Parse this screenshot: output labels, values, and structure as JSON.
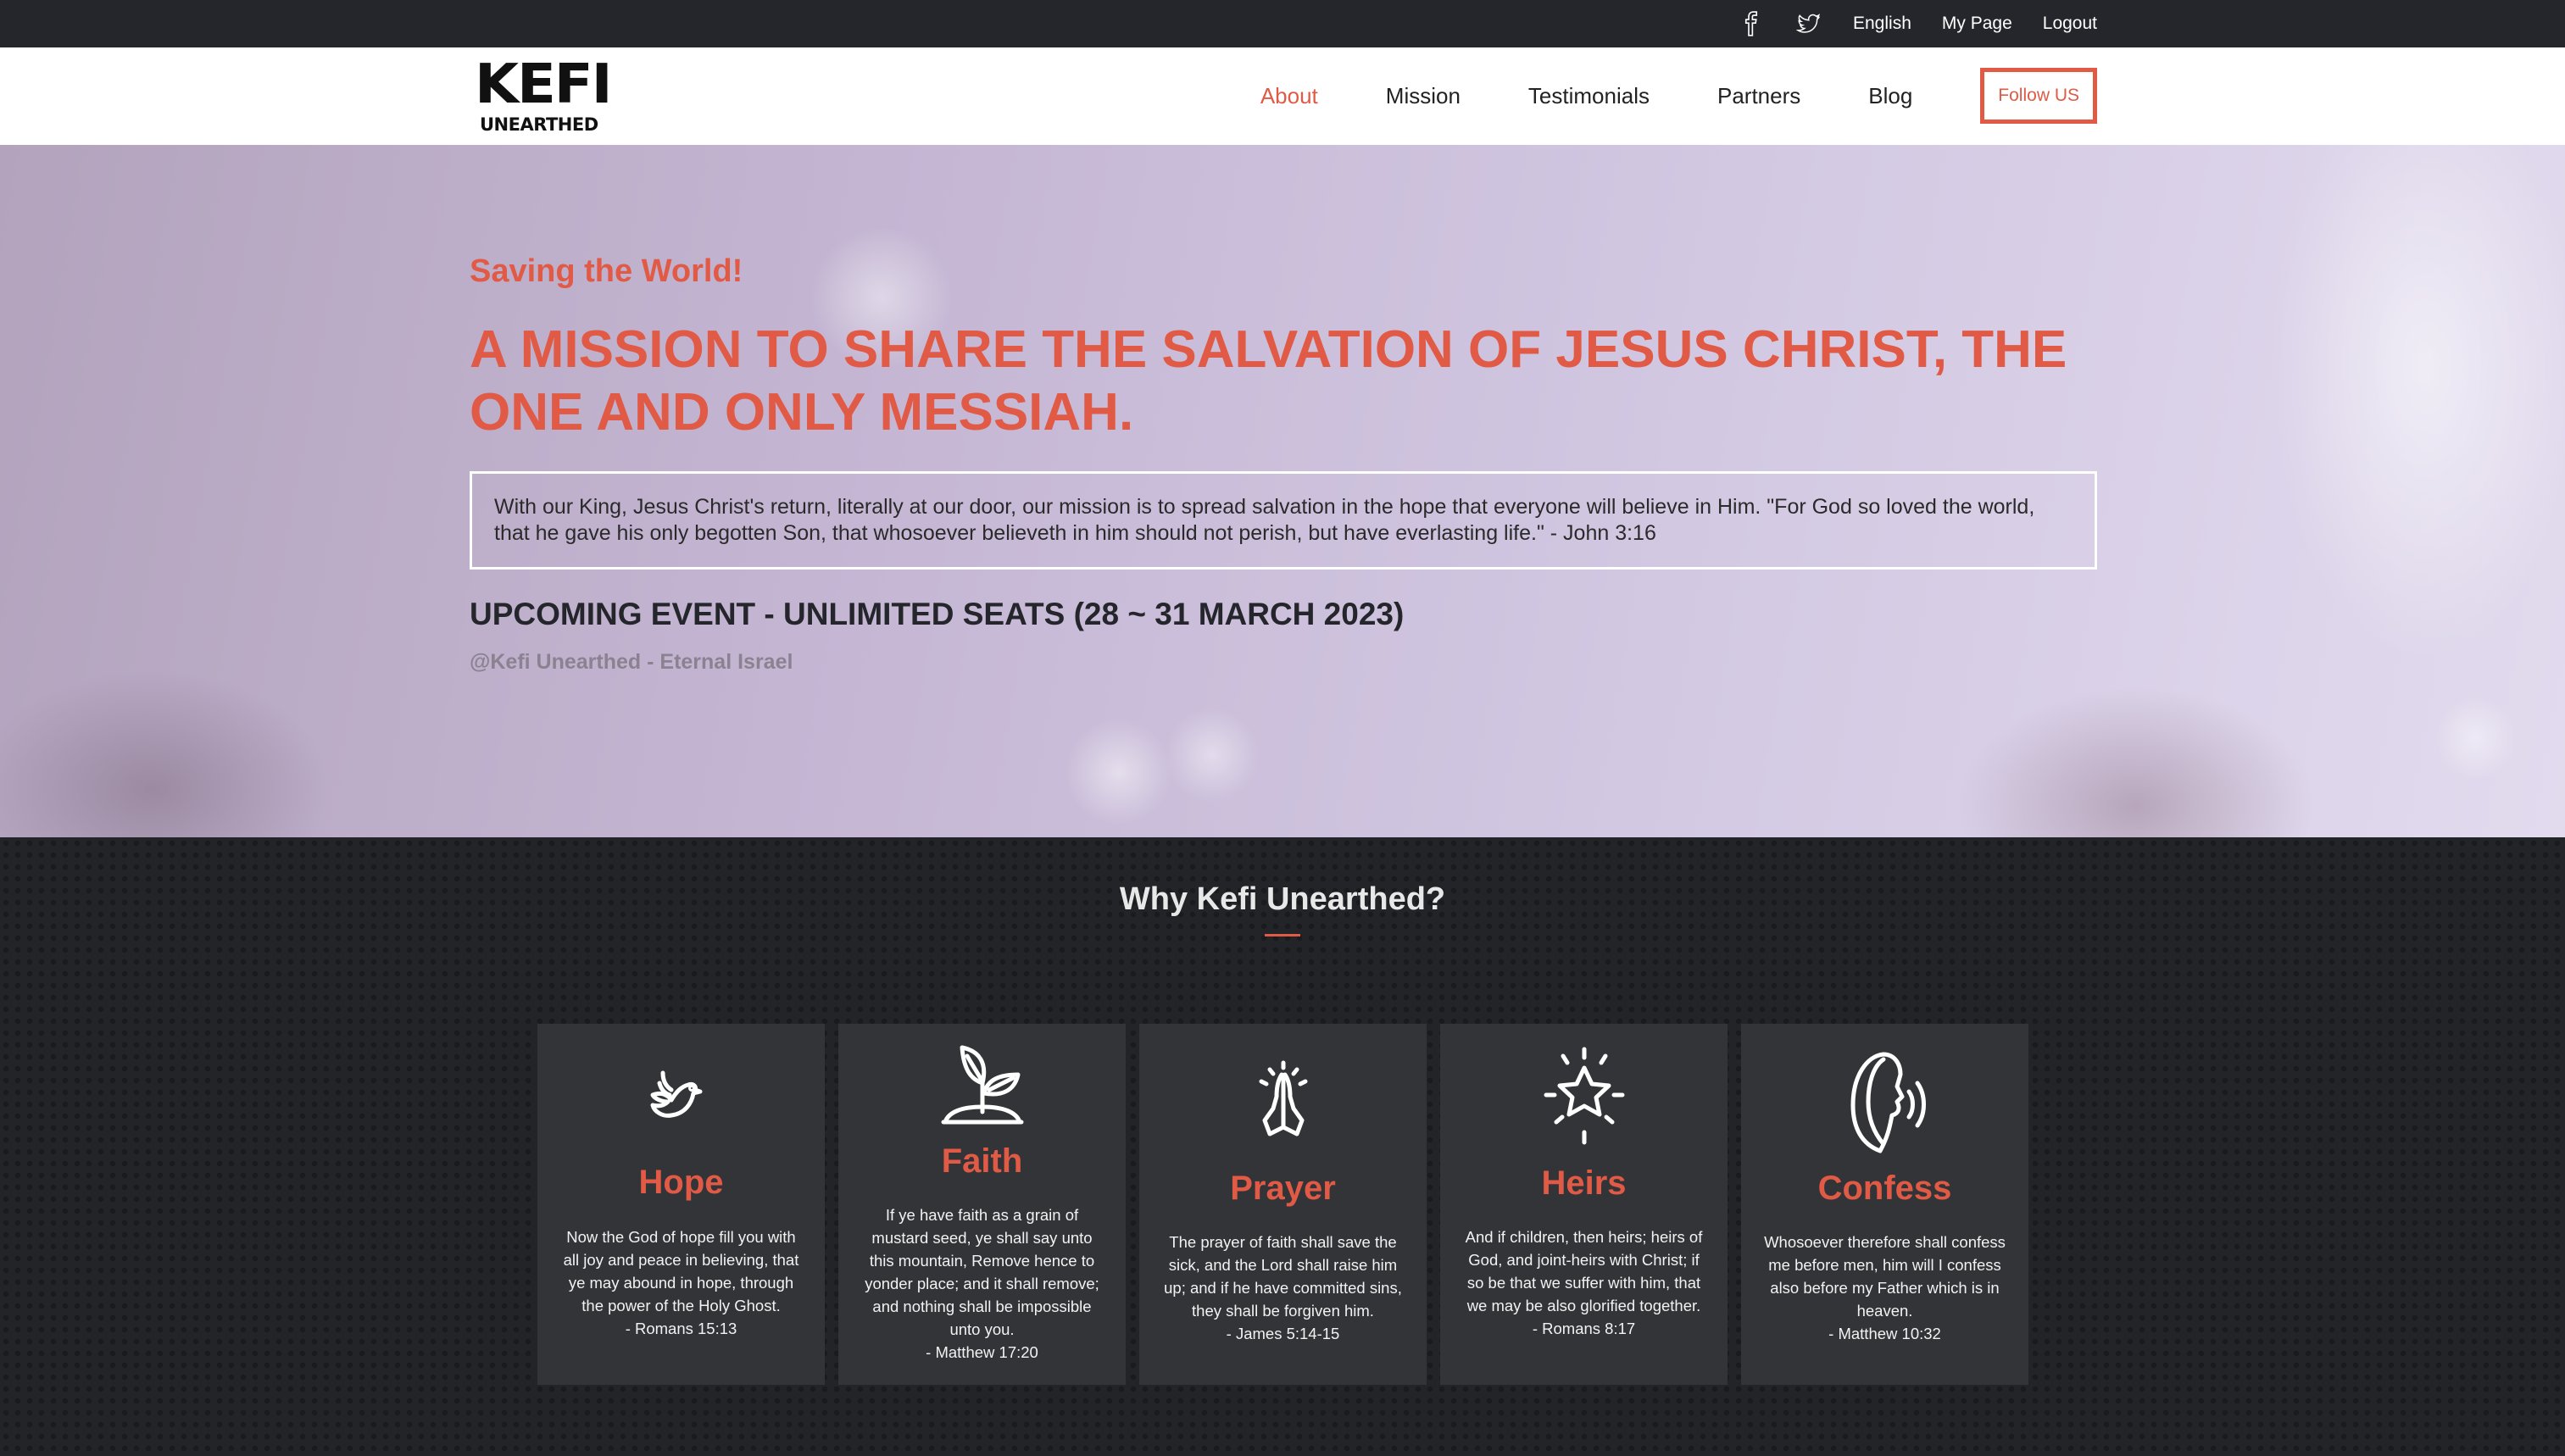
{
  "topbar": {
    "social": [
      {
        "icon": "facebook-icon"
      },
      {
        "icon": "twitter-icon"
      }
    ],
    "language": "English",
    "my_page": "My Page",
    "logout": "Logout"
  },
  "nav": {
    "logo_top": "KEFI",
    "logo_bottom": "UNEARTHED",
    "items": [
      "About",
      "Mission",
      "Testimonials",
      "Partners",
      "Blog"
    ],
    "active": "About",
    "follow": "Follow US"
  },
  "hero": {
    "kicker": "Saving the World!",
    "headline": "A MISSION TO SHARE THE SALVATION OF JESUS CHRIST, THE ONE AND ONLY MESSIAH.",
    "quote": "With our King, Jesus Christ's return, literally at our door, our mission is to spread salvation in the hope that everyone will believe in Him. \"For God so loved the world, that he gave his only begotten Son, that whosoever believeth in him should not perish, but have everlasting life.\" - John 3:16",
    "event": "UPCOMING EVENT - UNLIMITED SEATS (28 ~ 31 MARCH 2023)",
    "event_sub": "@Kefi Unearthed - Eternal Israel"
  },
  "why": {
    "title": "Why Kefi Unearthed?",
    "cards": [
      {
        "icon": "dove-icon",
        "name": "Hope",
        "text": "Now the God of hope fill you with all joy and peace in believing, that ye may abound in hope, through the power of the Holy Ghost.",
        "ref": "- Romans 15:13"
      },
      {
        "icon": "sprout-icon",
        "name": "Faith",
        "text": "If ye have faith as a grain of mustard seed, ye shall say unto this mountain, Remove hence to yonder place; and it shall remove; and nothing shall be impossible unto you.",
        "ref": "- Matthew 17:20"
      },
      {
        "icon": "praying-hands-icon",
        "name": "Prayer",
        "text": "The prayer of faith shall save the sick, and the Lord shall raise him up; and if he have committed sins, they shall be forgiven him.",
        "ref": "- James 5:14-15"
      },
      {
        "icon": "star-icon",
        "name": "Heirs",
        "text": "And if children, then heirs; heirs of God, and joint-heirs with Christ; if so be that we suffer with him, that we may be also glorified together.",
        "ref": "- Romans 8:17"
      },
      {
        "icon": "speaking-head-icon",
        "name": "Confess",
        "text": "Whosoever therefore shall confess me before men, him will I confess also before my Father which is in heaven.",
        "ref": "- Matthew 10:32"
      }
    ]
  }
}
